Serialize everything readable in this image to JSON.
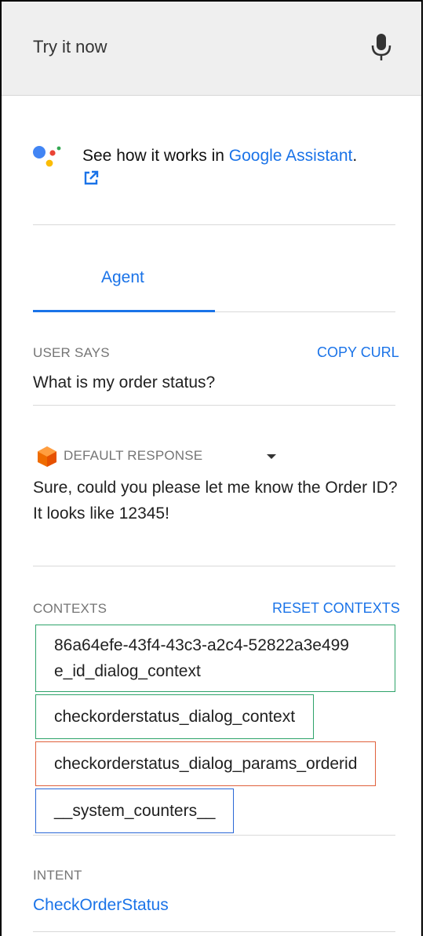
{
  "header": {
    "title": "Try it now",
    "mic_icon": "microphone-icon"
  },
  "assistant": {
    "logo_icon": "google-assistant-logo-icon",
    "text_prefix": "See how it works in ",
    "link_text": "Google Assistant",
    "text_suffix": ".",
    "external_icon": "external-link-icon"
  },
  "tabs": [
    {
      "label": "Agent",
      "active": true
    }
  ],
  "user_says": {
    "label": "USER SAYS",
    "action": "COPY CURL",
    "text": "What is my order status?"
  },
  "response": {
    "icon": "dialogflow-icon",
    "label": "DEFAULT RESPONSE",
    "dropdown_icon": "chevron-down-icon",
    "text": "Sure, could you please let me know the Order ID? It looks like 12345!"
  },
  "contexts": {
    "label": "CONTEXTS",
    "action": "RESET CONTEXTS",
    "items": [
      {
        "name": "86a64efe-43f4-43c3-a2c4-52822a3e499e_id_dialog_context",
        "line1": "86a64efe-43f4-43c3-a2c4-52822a3e499",
        "line2": "e_id_dialog_context",
        "color": "#2ea36a"
      },
      {
        "name": "checkorderstatus_dialog_context",
        "color": "#2ea36a"
      },
      {
        "name": "checkorderstatus_dialog_params_orderid",
        "color": "#e0613c"
      },
      {
        "name": "__system_counters__",
        "color": "#2a67d6"
      }
    ]
  },
  "intent": {
    "label": "INTENT",
    "value": "CheckOrderStatus"
  },
  "colors": {
    "accent": "#1a73e8",
    "header_bg": "#efefef",
    "context_green": "#2ea36a",
    "context_red": "#e0613c",
    "context_blue": "#2a67d6"
  }
}
